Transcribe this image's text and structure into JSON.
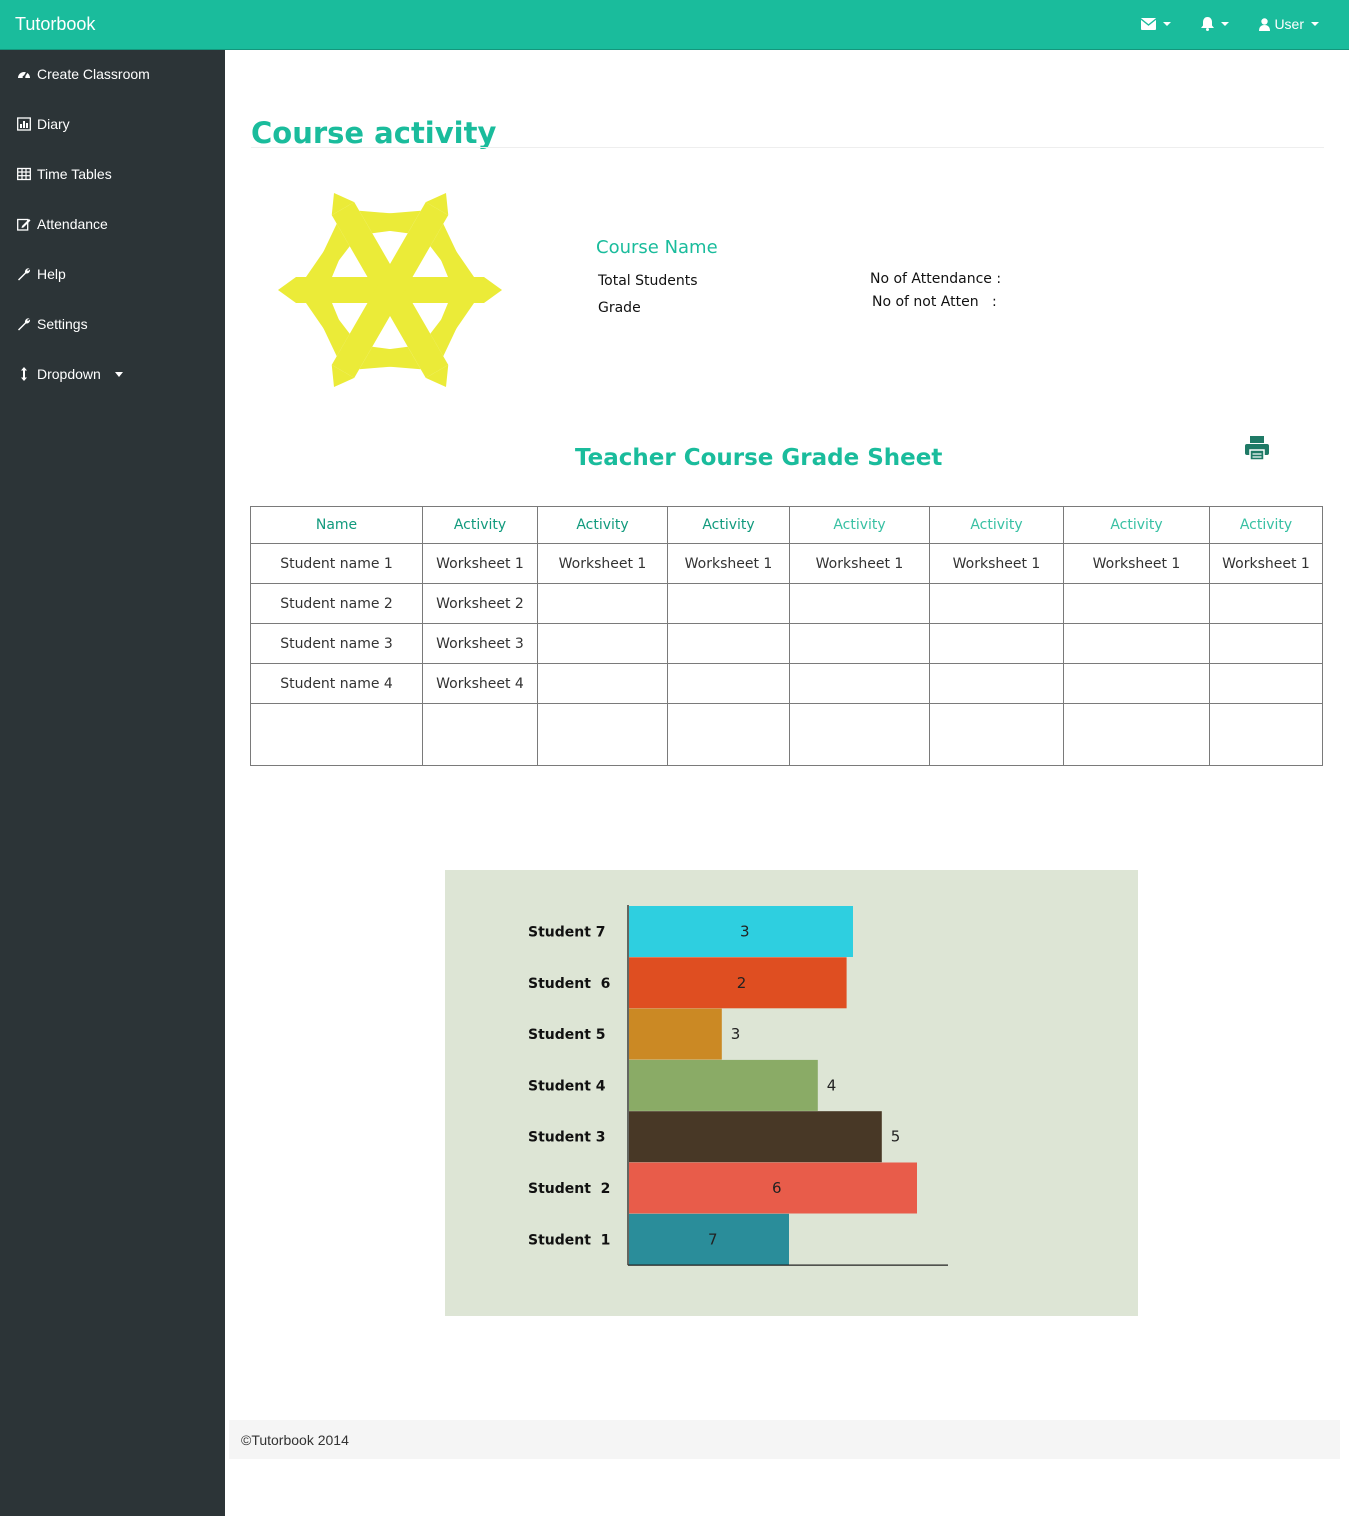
{
  "app": {
    "brand": "Tutorbook"
  },
  "topnav": {
    "user_label": "User"
  },
  "sidebar": {
    "items": [
      {
        "label": "Create Classroom",
        "icon": "dashboard-icon"
      },
      {
        "label": "Diary",
        "icon": "bar-chart-icon"
      },
      {
        "label": "Time Tables",
        "icon": "table-icon"
      },
      {
        "label": "Attendance",
        "icon": "edit-icon"
      },
      {
        "label": "Help",
        "icon": "wrench-icon"
      },
      {
        "label": "Settings",
        "icon": "wrench-icon"
      },
      {
        "label": "Dropdown",
        "icon": "arrows-vertical-icon"
      }
    ]
  },
  "page": {
    "title": "Course activity",
    "course_name": "Course Name",
    "total_students_label": "Total Students",
    "grade_label": "Grade",
    "attendance_label": "No of Attendance :",
    "not_attended_label": "No of not Atten   :"
  },
  "grade_sheet": {
    "title": "Teacher Course Grade Sheet",
    "headers": [
      "Name",
      "Activity",
      "Activity",
      "Activity",
      "Activity",
      "Activity",
      "Activity",
      "Activity"
    ],
    "rows": [
      [
        "Student name 1",
        "Worksheet 1",
        "Worksheet 1",
        "Worksheet 1",
        "Worksheet 1",
        "Worksheet 1",
        "Worksheet 1",
        "Worksheet 1"
      ],
      [
        "Student name 2",
        "Worksheet 2",
        "",
        "",
        "",
        "",
        "",
        ""
      ],
      [
        "Student name 3",
        "Worksheet 3",
        "",
        "",
        "",
        "",
        "",
        ""
      ],
      [
        "Student name 4",
        "Worksheet 4",
        "",
        "",
        "",
        "",
        "",
        ""
      ],
      [
        "",
        "",
        "",
        "",
        "",
        "",
        "",
        ""
      ]
    ]
  },
  "chart_data": {
    "type": "bar",
    "orientation": "horizontal",
    "categories": [
      "Student 7",
      "Student  6",
      "Student 5",
      "Student 4",
      "Student 3",
      "Student  2",
      "Student  1"
    ],
    "values": [
      3,
      2,
      3,
      4,
      5,
      6,
      7
    ],
    "bar_lengths": [
      0.7,
      0.68,
      0.29,
      0.59,
      0.79,
      0.9,
      0.5
    ],
    "colors": [
      "#2ecfe0",
      "#df4e21",
      "#cb8924",
      "#8aab66",
      "#483826",
      "#e85c4a",
      "#2a8d9a"
    ],
    "label_positions": [
      "inside",
      "inside",
      "outside",
      "outside",
      "outside",
      "inside",
      "inside"
    ],
    "background": "#dde5d5"
  },
  "footer": {
    "text": "©Tutorbook 2014"
  },
  "colors": {
    "accent": "#1abc9c",
    "sidebar": "#2c3437"
  }
}
